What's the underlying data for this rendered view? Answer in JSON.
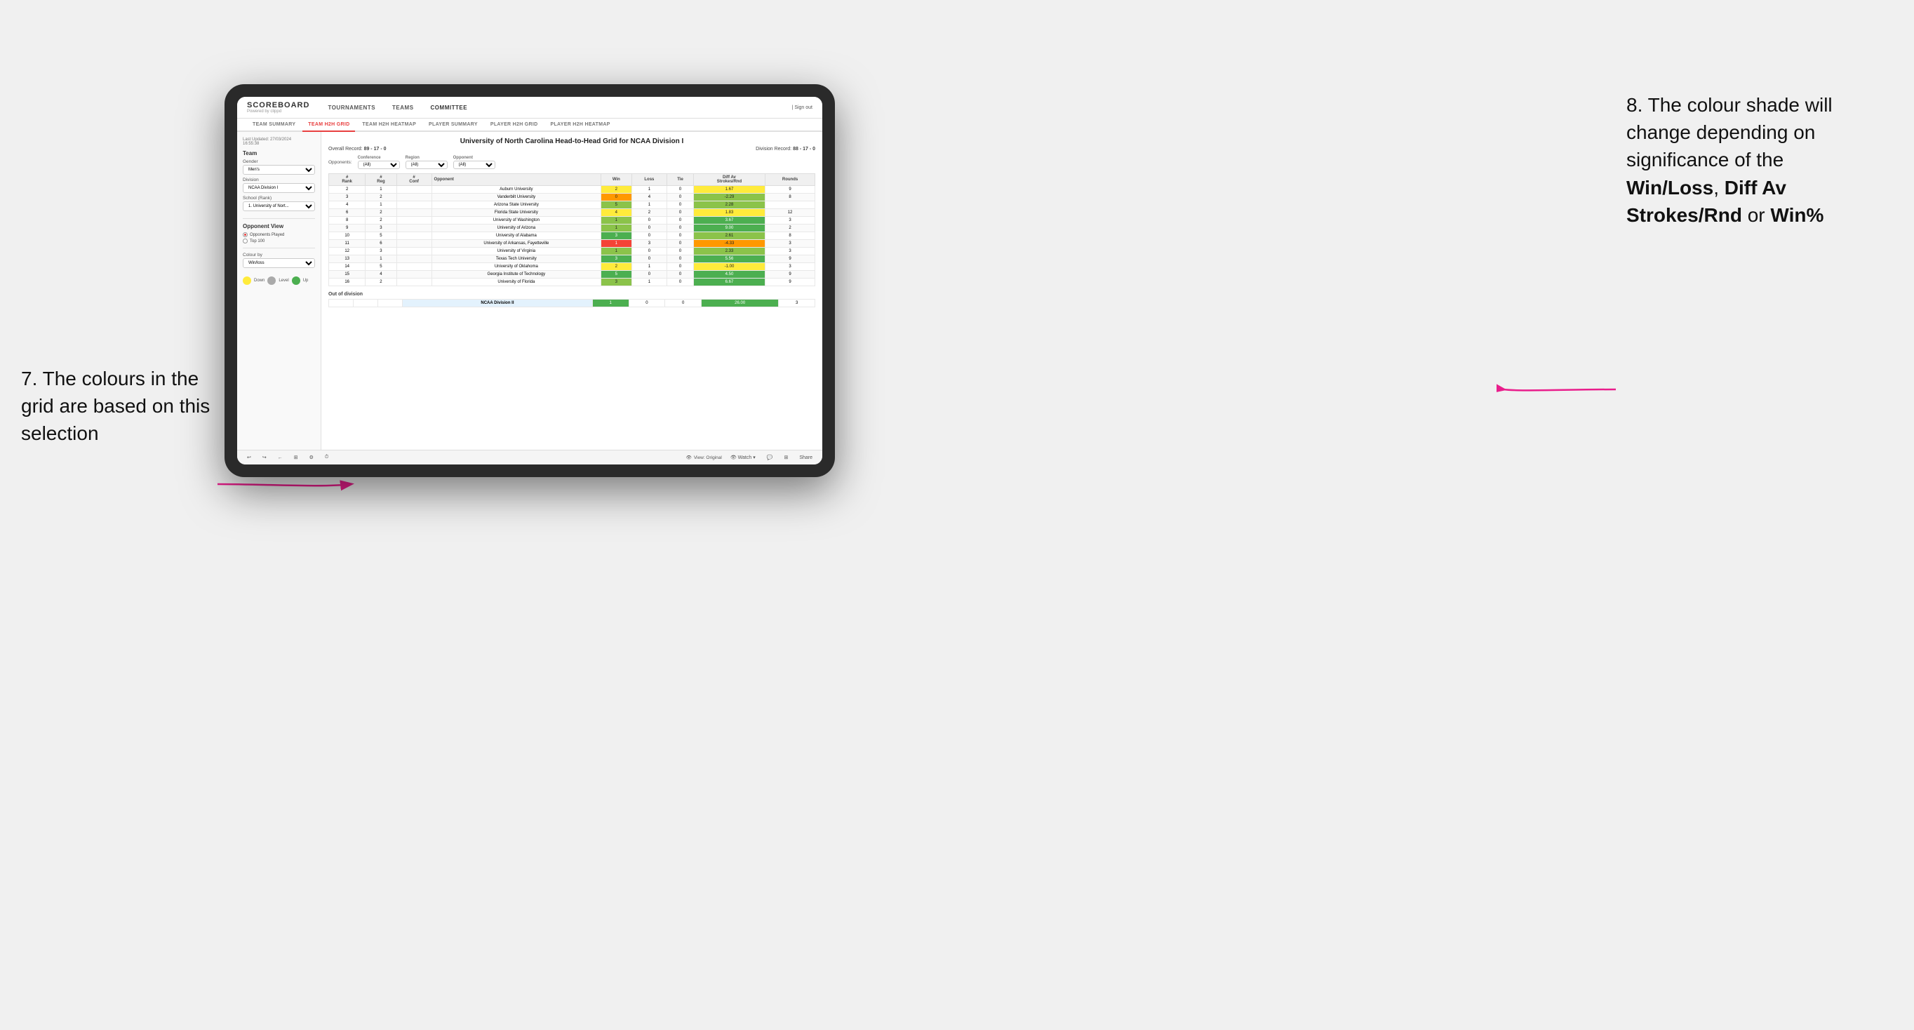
{
  "annotations": {
    "left_title": "7. The colours in the grid are based on this selection",
    "right_title": "8. The colour shade will change depending on significance of the",
    "right_bold1": "Win/Loss",
    "right_bold2": "Diff Av Strokes/Rnd",
    "right_bold3": "Win%",
    "right_or1": ", ",
    "right_or2": " or "
  },
  "nav": {
    "logo": "SCOREBOARD",
    "logo_sub": "Powered by clippd",
    "links": [
      "TOURNAMENTS",
      "TEAMS",
      "COMMITTEE"
    ],
    "sign_out": "Sign out"
  },
  "sub_tabs": [
    "TEAM SUMMARY",
    "TEAM H2H GRID",
    "TEAM H2H HEATMAP",
    "PLAYER SUMMARY",
    "PLAYER H2H GRID",
    "PLAYER H2H HEATMAP"
  ],
  "active_sub_tab": "TEAM H2H GRID",
  "sidebar": {
    "last_updated_label": "Last Updated: 27/03/2024",
    "last_updated_time": "16:55:38",
    "team_section": "Team",
    "gender_label": "Gender",
    "gender_value": "Men's",
    "division_label": "Division",
    "division_value": "NCAA Division I",
    "school_label": "School (Rank)",
    "school_value": "1. University of Nort...",
    "opponent_view_label": "Opponent View",
    "radio1": "Opponents Played",
    "radio2": "Top 100",
    "colour_by_label": "Colour by",
    "colour_by_value": "Win/loss",
    "legend": {
      "down_label": "Down",
      "level_label": "Level",
      "up_label": "Up"
    }
  },
  "grid": {
    "title": "University of North Carolina Head-to-Head Grid for NCAA Division I",
    "overall_record": "89 - 17 - 0",
    "division_record": "88 - 17 - 0",
    "filter_conference_label": "Conference",
    "filter_conference_value": "(All)",
    "filter_region_label": "Region",
    "filter_region_value": "(All)",
    "filter_opponent_label": "Opponent",
    "filter_opponent_value": "(All)",
    "opponents_label": "Opponents:",
    "columns": [
      "#\nRank",
      "#\nReg",
      "#\nConf",
      "Opponent",
      "Win",
      "Loss",
      "Tie",
      "Diff Av\nStrokes/Rnd",
      "Rounds"
    ],
    "rows": [
      {
        "rank": "2",
        "reg": "1",
        "conf": "",
        "name": "Auburn University",
        "win": "2",
        "loss": "1",
        "tie": "0",
        "diff": "1.67",
        "rounds": "9",
        "win_color": "cell-yellow",
        "diff_color": "cell-yellow"
      },
      {
        "rank": "3",
        "reg": "2",
        "conf": "",
        "name": "Vanderbilt University",
        "win": "0",
        "loss": "4",
        "tie": "0",
        "diff": "-2.29",
        "rounds": "8",
        "win_color": "cell-orange",
        "diff_color": "cell-green-mid"
      },
      {
        "rank": "4",
        "reg": "1",
        "conf": "",
        "name": "Arizona State University",
        "win": "5",
        "loss": "1",
        "tie": "0",
        "diff": "2.28",
        "rounds": "",
        "win_color": "cell-green-mid",
        "diff_color": "cell-green-mid"
      },
      {
        "rank": "6",
        "reg": "2",
        "conf": "",
        "name": "Florida State University",
        "win": "4",
        "loss": "2",
        "tie": "0",
        "diff": "1.83",
        "rounds": "12",
        "win_color": "cell-yellow",
        "diff_color": "cell-yellow"
      },
      {
        "rank": "8",
        "reg": "2",
        "conf": "",
        "name": "University of Washington",
        "win": "1",
        "loss": "0",
        "tie": "0",
        "diff": "3.67",
        "rounds": "3",
        "win_color": "cell-green-mid",
        "diff_color": "cell-green-dark"
      },
      {
        "rank": "9",
        "reg": "3",
        "conf": "",
        "name": "University of Arizona",
        "win": "1",
        "loss": "0",
        "tie": "0",
        "diff": "9.00",
        "rounds": "2",
        "win_color": "cell-green-mid",
        "diff_color": "cell-green-dark"
      },
      {
        "rank": "10",
        "reg": "5",
        "conf": "",
        "name": "University of Alabama",
        "win": "3",
        "loss": "0",
        "tie": "0",
        "diff": "2.61",
        "rounds": "8",
        "win_color": "cell-green-dark",
        "diff_color": "cell-green-mid"
      },
      {
        "rank": "11",
        "reg": "6",
        "conf": "",
        "name": "University of Arkansas, Fayetteville",
        "win": "1",
        "loss": "3",
        "tie": "0",
        "diff": "-4.33",
        "rounds": "3",
        "win_color": "cell-red",
        "diff_color": "cell-orange"
      },
      {
        "rank": "12",
        "reg": "3",
        "conf": "",
        "name": "University of Virginia",
        "win": "1",
        "loss": "0",
        "tie": "0",
        "diff": "2.33",
        "rounds": "3",
        "win_color": "cell-green-mid",
        "diff_color": "cell-green-mid"
      },
      {
        "rank": "13",
        "reg": "1",
        "conf": "",
        "name": "Texas Tech University",
        "win": "3",
        "loss": "0",
        "tie": "0",
        "diff": "5.56",
        "rounds": "9",
        "win_color": "cell-green-dark",
        "diff_color": "cell-green-dark"
      },
      {
        "rank": "14",
        "reg": "5",
        "conf": "",
        "name": "University of Oklahoma",
        "win": "2",
        "loss": "1",
        "tie": "0",
        "diff": "-1.00",
        "rounds": "3",
        "win_color": "cell-yellow",
        "diff_color": "cell-yellow"
      },
      {
        "rank": "15",
        "reg": "4",
        "conf": "",
        "name": "Georgia Institute of Technology",
        "win": "5",
        "loss": "0",
        "tie": "0",
        "diff": "4.50",
        "rounds": "9",
        "win_color": "cell-green-dark",
        "diff_color": "cell-green-dark"
      },
      {
        "rank": "16",
        "reg": "2",
        "conf": "",
        "name": "University of Florida",
        "win": "3",
        "loss": "1",
        "tie": "0",
        "diff": "6.67",
        "rounds": "9",
        "win_color": "cell-green-mid",
        "diff_color": "cell-green-dark"
      }
    ],
    "out_division_label": "Out of division",
    "out_division_rows": [
      {
        "name": "NCAA Division II",
        "win": "1",
        "loss": "0",
        "tie": "0",
        "diff": "26.00",
        "rounds": "3",
        "win_color": "cell-green-dark",
        "diff_color": "cell-green-dark"
      }
    ]
  },
  "toolbar": {
    "view_label": "View: Original",
    "watch_label": "Watch",
    "share_label": "Share"
  }
}
